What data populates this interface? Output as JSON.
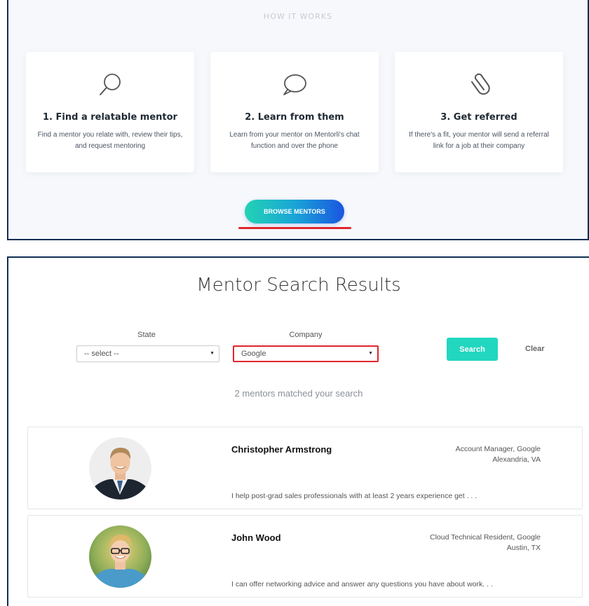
{
  "how_it_works": {
    "heading": "HOW IT WORKS",
    "steps": [
      {
        "icon": "search-icon",
        "title": "1. Find a relatable mentor",
        "desc": "Find a mentor you relate with, review their tips, and request mentoring"
      },
      {
        "icon": "chat-bubble-icon",
        "title": "2. Learn from them",
        "desc": "Learn from your mentor on Mentorli's chat function and over the phone"
      },
      {
        "icon": "paperclip-icon",
        "title": "3. Get referred",
        "desc": "If there's a fit, your mentor will send a referral link for a job at their company"
      }
    ],
    "browse_label": "BROWSE MENTORS"
  },
  "search": {
    "title": "Mentor Search Results",
    "state_label": "State",
    "state_value": "-- select --",
    "company_label": "Company",
    "company_value": "Google",
    "search_label": "Search",
    "clear_label": "Clear",
    "matched_text": "2 mentors matched your search"
  },
  "mentors": [
    {
      "name": "Christopher Armstrong",
      "role": "Account Manager, Google",
      "location": "Alexandria, VA",
      "bio": "I help post-grad sales professionals with at least 2 years experience get . . ."
    },
    {
      "name": "John Wood",
      "role": "Cloud Technical Resident, Google",
      "location": "Austin, TX",
      "bio": "I can offer networking advice and answer any questions you have about work. . ."
    }
  ],
  "colors": {
    "accent": "#22d7bf",
    "gradient_end": "#1a55e0",
    "highlight": "#e1262d",
    "frame": "#0f2d55"
  }
}
